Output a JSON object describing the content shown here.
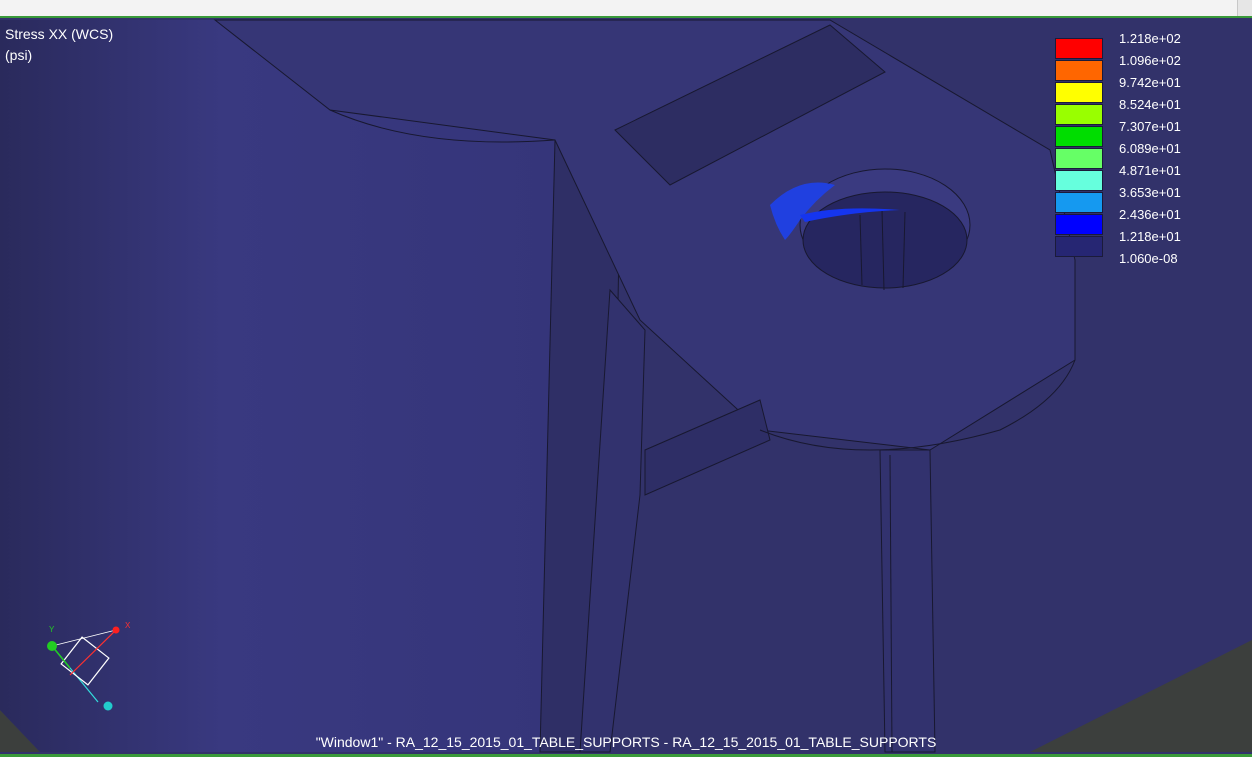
{
  "result": {
    "quantity": "Stress XX (WCS)",
    "units": "(psi)"
  },
  "legend": {
    "colors": [
      "#ff0000",
      "#ff6600",
      "#ffff00",
      "#99ff00",
      "#00dd00",
      "#66ff66",
      "#66ffdd",
      "#1599f0",
      "#0000ff",
      "#262673"
    ],
    "labels": [
      "1.218e+02",
      "1.096e+02",
      "9.742e+01",
      "8.524e+01",
      "7.307e+01",
      "6.089e+01",
      "4.871e+01",
      "3.653e+01",
      "2.436e+01",
      "1.218e+01",
      "1.060e-08"
    ]
  },
  "triad": {
    "x_label": "X",
    "y_label": "Y",
    "x_color": "#ff2020",
    "y_color": "#22cc22",
    "z_color": "#22cccc"
  },
  "status": {
    "window_caption": "\"Window1\" - RA_12_15_2015_01_TABLE_SUPPORTS - RA_12_15_2015_01_TABLE_SUPPORTS"
  },
  "colors": {
    "background": "#32326a",
    "accent_border": "#3a9a3a"
  }
}
